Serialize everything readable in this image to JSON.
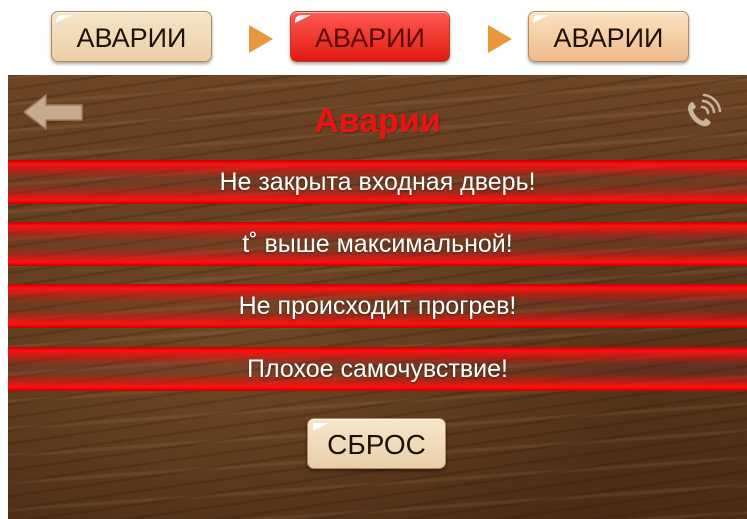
{
  "state_preview": {
    "normal_label": "АВАРИИ",
    "pressed_label": "АВАРИИ",
    "hover_label": "АВАРИИ"
  },
  "panel": {
    "title": "Аварии",
    "alarms": [
      "Не закрыта входная дверь!",
      "t˚ выше максимальной!",
      "Не происходит прогрев!",
      "Плохое самочувствие!"
    ],
    "reset_label": "СБРОС"
  },
  "icons": {
    "back": "arrow-left-icon",
    "call": "phone-ringing-icon"
  },
  "colors": {
    "title": "#ee1313",
    "alarm_stripe": "#ff1010",
    "button_face": "#f6e5c9",
    "button_pressed": "#e11a12",
    "button_hover": "#efb98a",
    "separator_arrow": "#e8973c",
    "wood": "#5a381c"
  }
}
